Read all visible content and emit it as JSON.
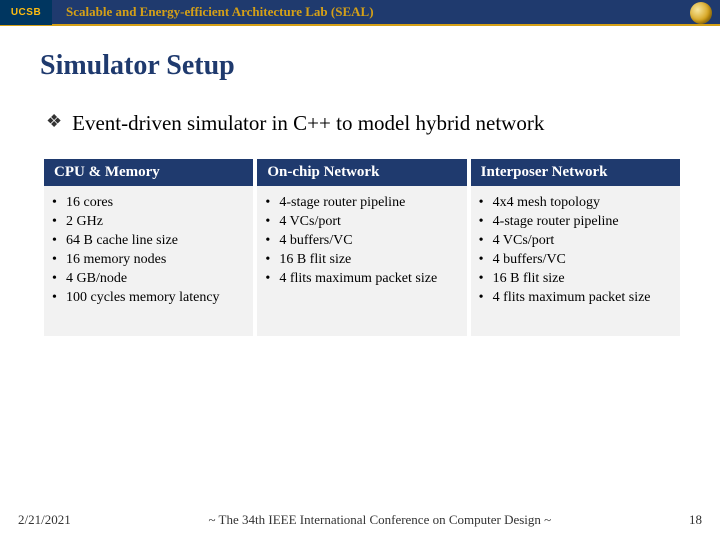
{
  "header": {
    "logo_left": "UCSB",
    "title": "Scalable and Energy-efficient Architecture Lab (SEAL)"
  },
  "slide": {
    "title": "Simulator Setup",
    "main_bullet": "Event-driven simulator in C++ to model hybrid network"
  },
  "columns": [
    {
      "header": "CPU & Memory",
      "items": [
        "16 cores",
        "2 GHz",
        "64 B cache line size",
        "16 memory nodes",
        "4 GB/node",
        "100 cycles memory latency"
      ]
    },
    {
      "header": "On-chip Network",
      "items": [
        "4-stage router pipeline",
        "4 VCs/port",
        "4 buffers/VC",
        "16 B flit size",
        "4 flits maximum packet size"
      ]
    },
    {
      "header": "Interposer Network",
      "items": [
        "4x4 mesh topology",
        "4-stage router pipeline",
        "4 VCs/port",
        "4 buffers/VC",
        "16 B flit size",
        "4 flits maximum packet size"
      ]
    }
  ],
  "footer": {
    "date": "2/21/2021",
    "center": "~ The 34th IEEE International Conference on Computer Design ~",
    "page": "18"
  }
}
